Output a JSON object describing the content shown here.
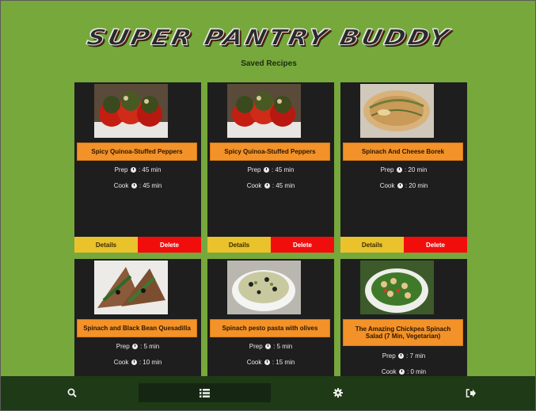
{
  "app": {
    "title": "SUPER PANTRY BUDDY",
    "subtitle": "Saved Recipes"
  },
  "recipes": [
    {
      "title": "Spicy Quinoa-Stuffed Peppers",
      "prep_label": "Prep",
      "prep": ": 45 min",
      "cook_label": "Cook",
      "cook": ": 45 min",
      "details": "Details",
      "delete": "Delete"
    },
    {
      "title": "Spicy Quinoa-Stuffed Peppers",
      "prep_label": "Prep",
      "prep": ": 45 min",
      "cook_label": "Cook",
      "cook": ": 45 min",
      "details": "Details",
      "delete": "Delete"
    },
    {
      "title": "Spinach And Cheese Borek",
      "prep_label": "Prep",
      "prep": ": 20 min",
      "cook_label": "Cook",
      "cook": ": 20 min",
      "details": "Details",
      "delete": "Delete"
    },
    {
      "title": "Spinach and Black Bean Quesadilla",
      "prep_label": "Prep",
      "prep": ": 5 min",
      "cook_label": "Cook",
      "cook": ": 10 min"
    },
    {
      "title": "Spinach pesto pasta with olives",
      "prep_label": "Prep",
      "prep": ": 5 min",
      "cook_label": "Cook",
      "cook": ": 15 min"
    },
    {
      "title": "The Amazing Chickpea Spinach Salad (7 Min, Vegetarian)",
      "prep_label": "Prep",
      "prep": ": 7 min",
      "cook_label": "Cook",
      "cook": ": 0 min"
    }
  ],
  "nav": [
    {
      "name": "search",
      "icon": "search-icon"
    },
    {
      "name": "saved-list",
      "icon": "list-icon",
      "active": true
    },
    {
      "name": "settings",
      "icon": "gear-icon"
    },
    {
      "name": "logout",
      "icon": "sign-out-icon"
    }
  ],
  "colors": {
    "background": "#76a83c",
    "card": "#1e1e1e",
    "title_bar": "#f39228",
    "details": "#e9c22c",
    "delete": "#f20d0d",
    "navbar": "#1f3a16"
  }
}
